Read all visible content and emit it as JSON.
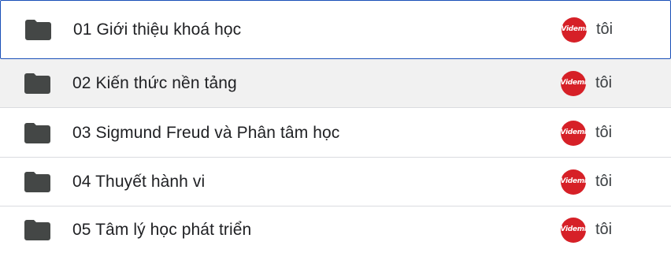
{
  "files": [
    {
      "name": "01 Giới thiệu khoá học",
      "owner": "tôi",
      "icon": "folder-icon",
      "avatar_logo": "Videmi"
    },
    {
      "name": "02 Kiến thức nền tảng",
      "owner": "tôi",
      "icon": "folder-icon",
      "avatar_logo": "Videmi"
    },
    {
      "name": "03 Sigmund Freud và Phân tâm học",
      "owner": "tôi",
      "icon": "folder-icon",
      "avatar_logo": "Videmi"
    },
    {
      "name": "04 Thuyết hành vi",
      "owner": "tôi",
      "icon": "folder-icon",
      "avatar_logo": "Videmi"
    },
    {
      "name": "05 Tâm lý học phát triển",
      "owner": "tôi",
      "icon": "folder-icon",
      "avatar_logo": "Videmi"
    }
  ],
  "colors": {
    "folder": "#444746",
    "avatar_bg": "#d62027",
    "selected_row_bg": "#f1f1f1",
    "focus_border": "#1a4fb8"
  }
}
